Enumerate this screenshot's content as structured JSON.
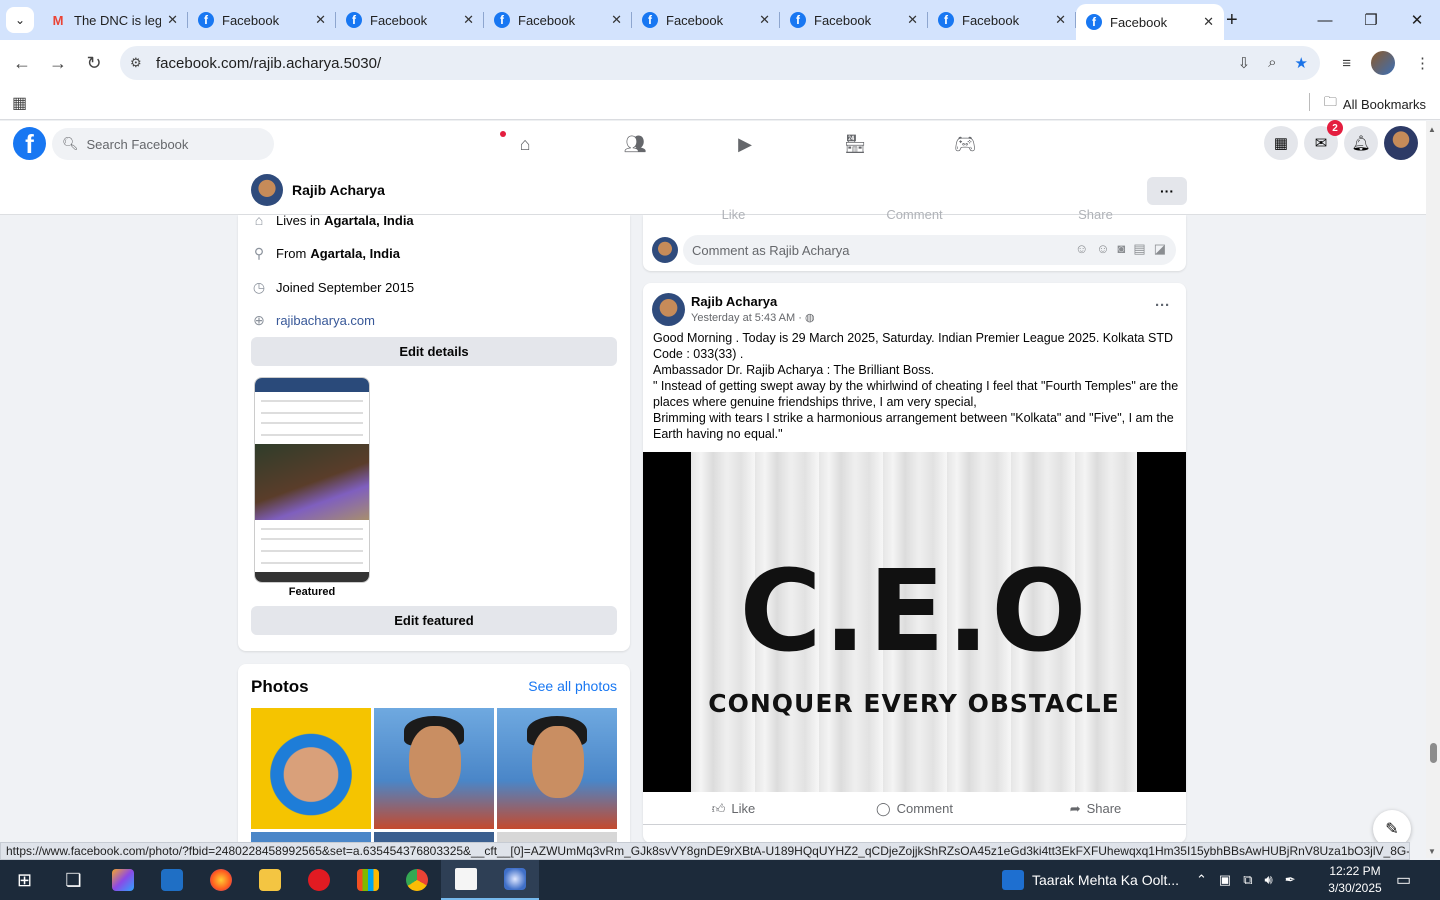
{
  "browser": {
    "tabs": [
      {
        "title": "The DNC is leg",
        "favicon": "gmail-icon",
        "active": false
      },
      {
        "title": "Facebook",
        "favicon": "facebook-icon",
        "active": false
      },
      {
        "title": "Facebook",
        "favicon": "facebook-icon",
        "active": false
      },
      {
        "title": "Facebook",
        "favicon": "facebook-icon",
        "active": false
      },
      {
        "title": "Facebook",
        "favicon": "facebook-icon",
        "active": false
      },
      {
        "title": "Facebook",
        "favicon": "facebook-icon",
        "active": false
      },
      {
        "title": "Facebook",
        "favicon": "facebook-icon",
        "active": false
      },
      {
        "title": "Facebook",
        "favicon": "facebook-icon",
        "active": true
      }
    ],
    "url": "facebook.com/rajib.acharya.5030/",
    "bookmarks_all_label": "All Bookmarks",
    "status_url": "https://www.facebook.com/photo/?fbid=2480228458992565&set=a.635454376803325&__cft__[0]=AZWUmMq3vRm_GJk8svVY8gnDE9rXBtA-U189HQqUYHZ2_qCDjeZojjkShRZsOA45z1eGd3ki4tt3EkFXFUhewqxq1Hm35I15ybhBBsAwHUBjRnV8Uza1bO3jlV_8G-D2ys..."
  },
  "facebook": {
    "search_placeholder": "Search Facebook",
    "messenger_badge": "2",
    "profile_name": "Rajib Acharya"
  },
  "intro": {
    "lives_prefix": "Lives in",
    "lives_place": "Agartala, India",
    "from_prefix": "From",
    "from_place": "Agartala, India",
    "joined": "Joined September 2015",
    "website": "rajibacharya.com",
    "edit_details": "Edit details",
    "featured_label": "Featured",
    "edit_featured": "Edit featured"
  },
  "photos": {
    "title": "Photos",
    "see_all": "See all photos"
  },
  "comment_box": {
    "ghost_actions": [
      "Like",
      "Comment",
      "Share"
    ],
    "placeholder": "Comment as Rajib Acharya"
  },
  "post": {
    "author": "Rajib Acharya",
    "time": "Yesterday at 5:43 AM",
    "privacy_icon": "globe-icon",
    "lines": [
      "Good Morning . Today is 29 March 2025, Saturday. Indian Premier League 2025. Kolkata STD Code : 033(33) .",
      "Ambassador Dr. Rajib Acharya : The Brilliant Boss.",
      "\" Instead of getting swept away by the whirlwind of cheating I feel that \"Fourth Temples\" are the places where genuine friendships thrive, I am very special,",
      "Brimming with tears I strike a harmonious arrangement between \"Kolkata\" and \"Five\", I am the Earth having no equal.\""
    ],
    "image_title": "C.E.O",
    "image_subtitle": "CONQUER EVERY OBSTACLE",
    "actions": {
      "like": "Like",
      "comment": "Comment",
      "share": "Share"
    }
  },
  "taskbar": {
    "news_text": "Taarak Mehta Ka Oolt...",
    "time": "12:22 PM",
    "date": "3/30/2025"
  }
}
